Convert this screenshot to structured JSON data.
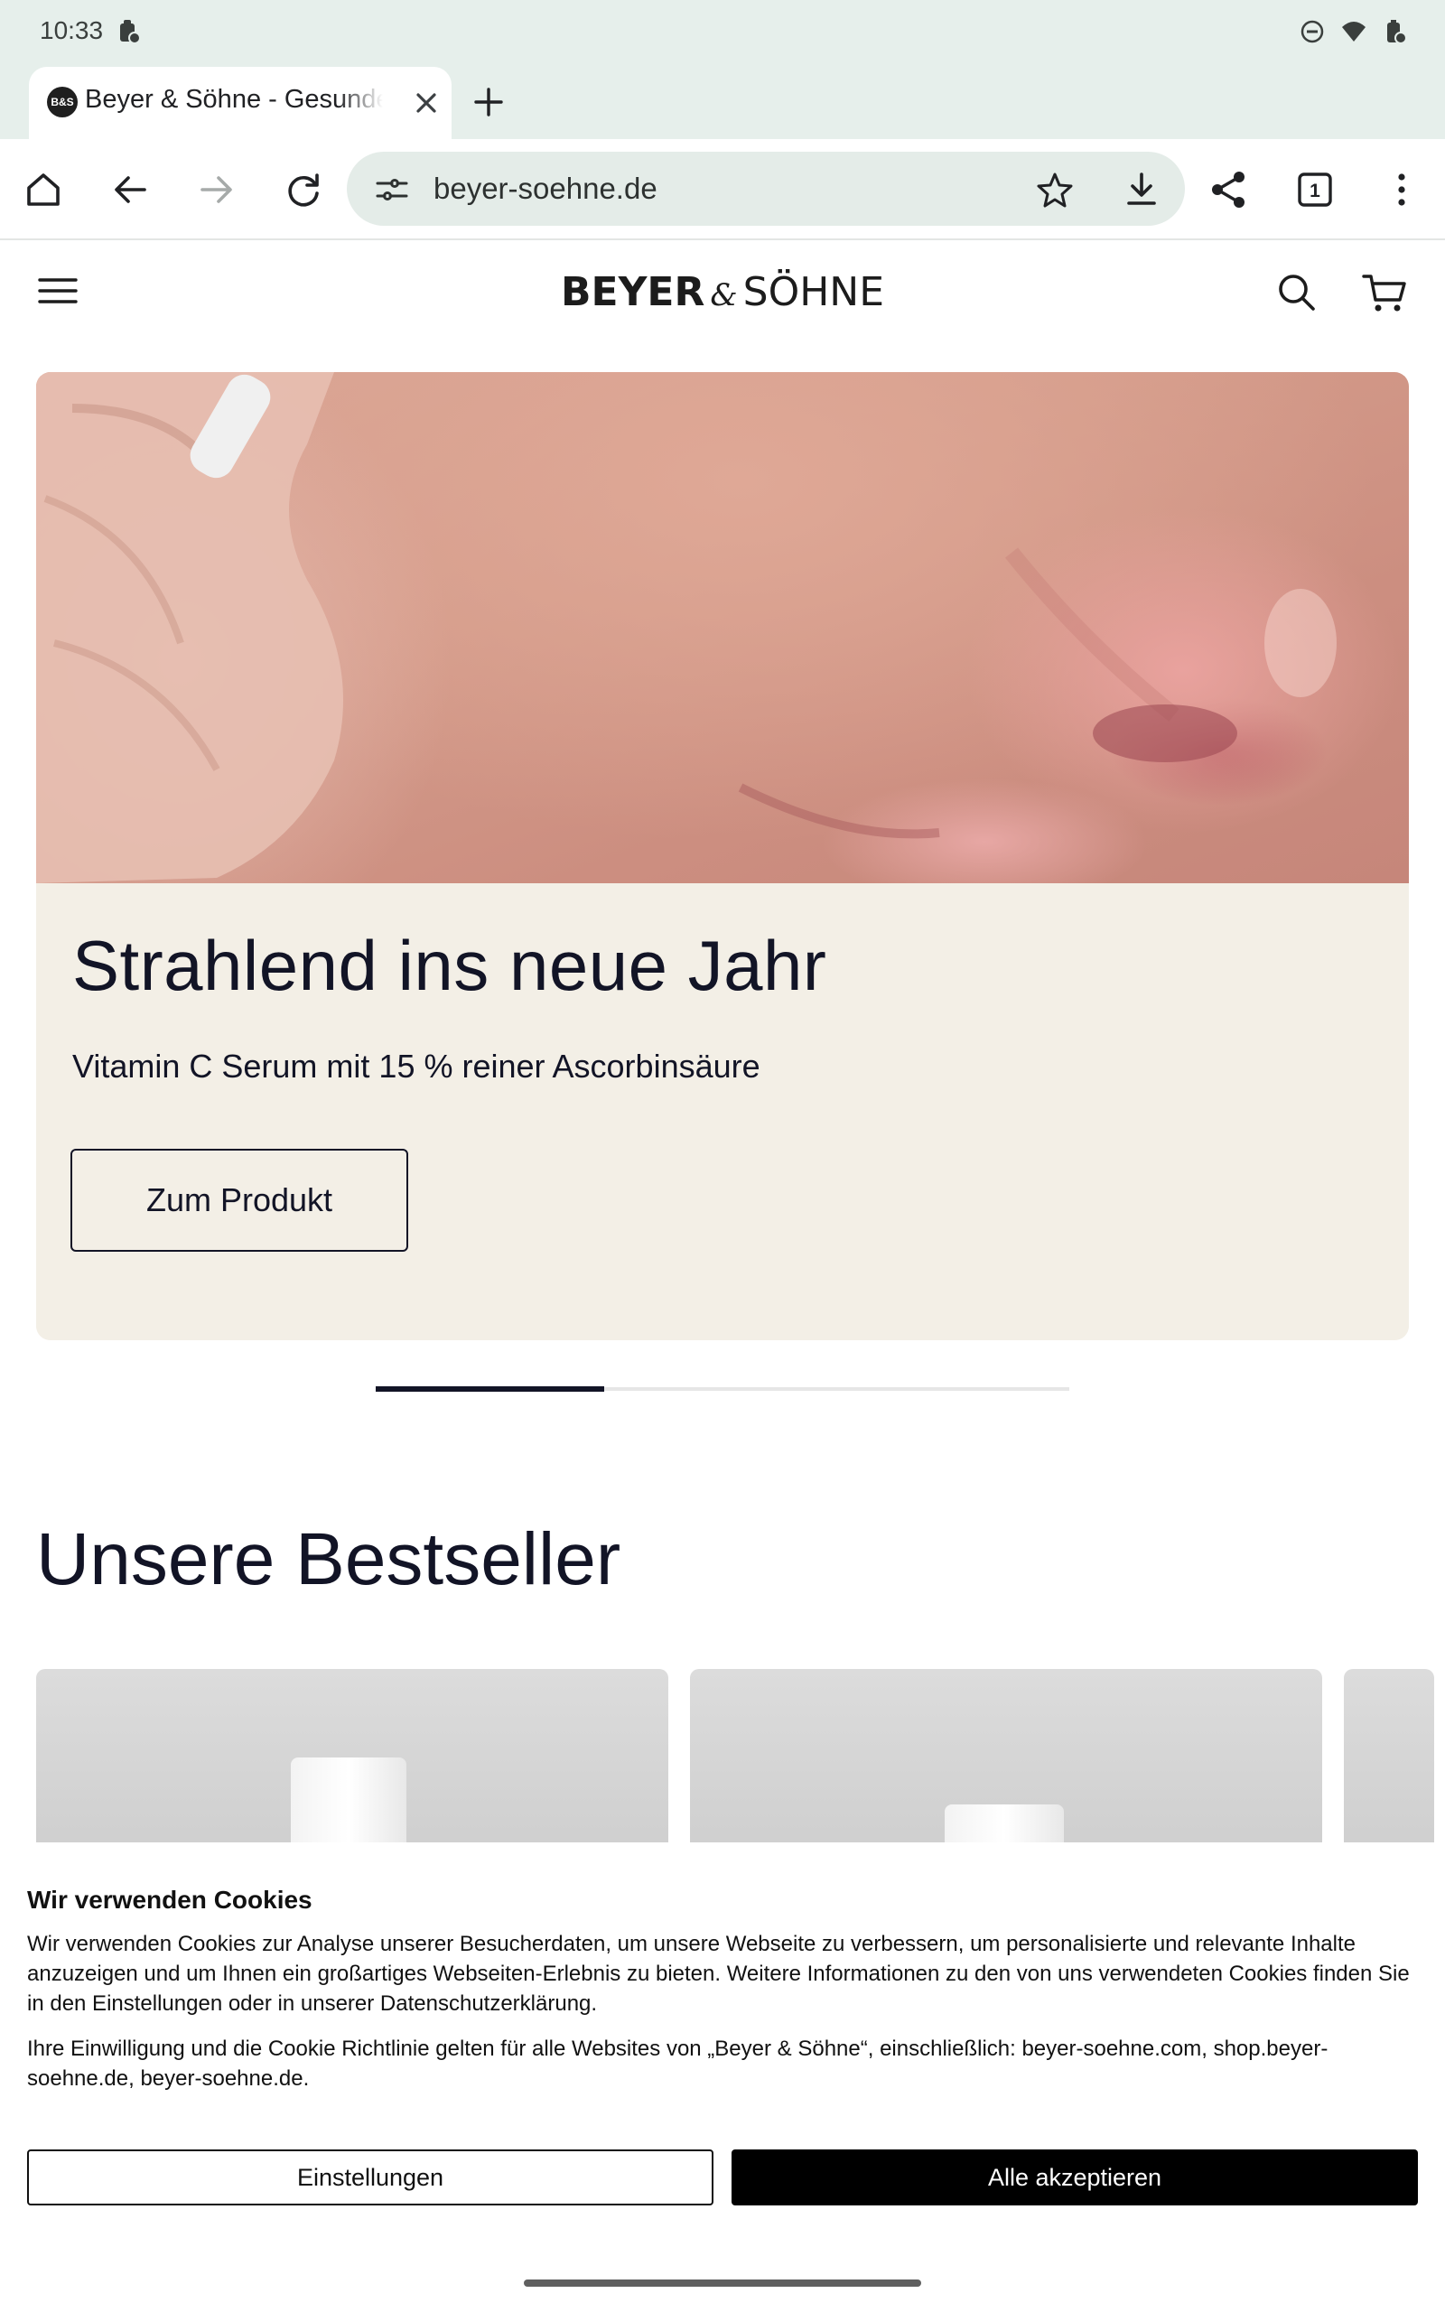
{
  "status_bar": {
    "time": "10:33",
    "left_icon": "notification-icon",
    "right_icons": [
      "do-not-disturb-icon",
      "wifi-icon",
      "battery-icon"
    ]
  },
  "browser": {
    "tab_title": "Beyer & Söhne - Gesunde Haut",
    "favicon_text": "B&S",
    "url": "beyer-soehne.de",
    "tab_count": "1"
  },
  "site_header": {
    "logo_part1": "BEYER",
    "logo_amp": "&",
    "logo_part2": "SÖHNE"
  },
  "hero": {
    "title": "Strahlend ins neue Jahr",
    "subtitle": "Vitamin C Serum mit 15 % reiner Ascorbinsäure",
    "button_label": "Zum Produkt",
    "carousel_progress": 0.33
  },
  "bestseller": {
    "title": "Unsere Bestseller"
  },
  "cookie_banner": {
    "title": "Wir verwenden Cookies",
    "paragraph1": "Wir verwenden Cookies zur Analyse unserer Besucherdaten, um unsere Webseite zu verbessern, um personalisierte und relevante Inhalte anzuzeigen und um Ihnen ein großartiges Webseiten-Erlebnis zu bieten. Weitere Informationen zu den von uns verwendeten Cookies finden Sie in den Einstellungen oder in unserer Datenschutzerklärung.",
    "paragraph2": "Ihre Einwilligung und die Cookie Richtlinie gelten für alle Websites von „Beyer & Söhne“, einschließlich: beyer-soehne.com, shop.beyer-soehne.de, beyer-soehne.de.",
    "settings_label": "Einstellungen",
    "accept_label": "Alle akzeptieren"
  }
}
